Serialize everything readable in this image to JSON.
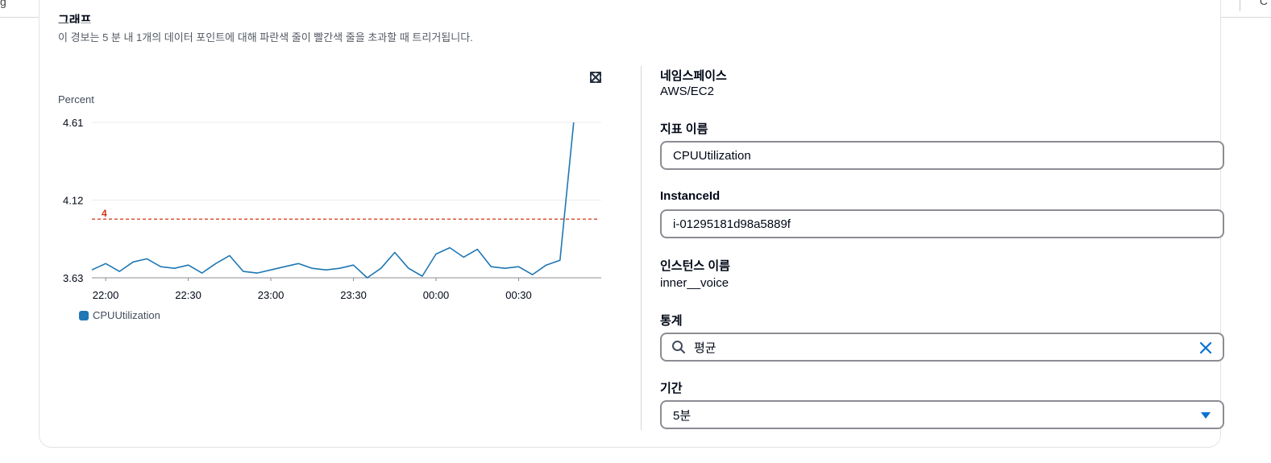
{
  "panel": {
    "title": "그래프",
    "description": "이 경보는 5 분 내 1개의 데이터 포인트에 대해 파란색 줄이 빨간색 줄을 초과할 때 트리거됩니다."
  },
  "chart_data": {
    "type": "line",
    "ylabel": "Percent",
    "ylim": [
      3.63,
      4.61
    ],
    "yticks": [
      "4.61",
      "4.12",
      "3.63"
    ],
    "x_ticks": [
      "22:00",
      "22:30",
      "23:00",
      "23:30",
      "00:00",
      "00:30"
    ],
    "threshold": {
      "value": 4,
      "label": "4",
      "color": "#d13212"
    },
    "series": [
      {
        "name": "CPUUtilization",
        "color": "#1f77b4",
        "x_start": "21:55",
        "interval_minutes": 5,
        "values": [
          3.68,
          3.72,
          3.67,
          3.73,
          3.75,
          3.7,
          3.69,
          3.71,
          3.66,
          3.72,
          3.77,
          3.67,
          3.66,
          3.68,
          3.7,
          3.72,
          3.69,
          3.68,
          3.69,
          3.71,
          3.63,
          3.69,
          3.79,
          3.69,
          3.64,
          3.78,
          3.82,
          3.76,
          3.81,
          3.7,
          3.69,
          3.7,
          3.65,
          3.71,
          3.74,
          4.61
        ]
      }
    ]
  },
  "legend": {
    "label": "CPUUtilization"
  },
  "details": {
    "namespace_label": "네임스페이스",
    "namespace_value": "AWS/EC2",
    "metric_label": "지표 이름",
    "metric_value": "CPUUtilization",
    "instance_id_label": "InstanceId",
    "instance_id_value": "i-01295181d98a5889f",
    "instance_name_label": "인스턴스 이름",
    "instance_name_value": "inner__voice",
    "statistic_label": "통계",
    "statistic_value": "평균",
    "period_label": "기간",
    "period_value": "5분"
  },
  "colors": {
    "accent": "#0972d3",
    "series": "#1f77b4",
    "threshold": "#d13212"
  },
  "icons": {
    "expand": "expand-icon",
    "search": "search-icon",
    "clear": "close-icon",
    "dropdown": "caret-down-icon"
  }
}
